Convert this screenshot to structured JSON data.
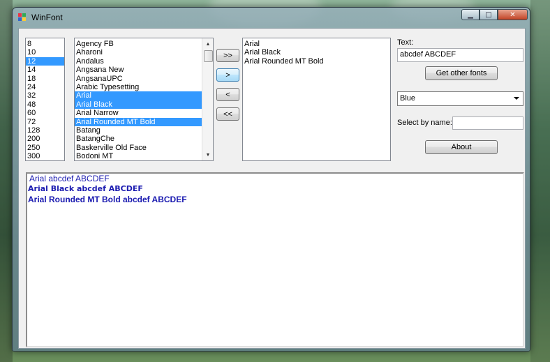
{
  "window": {
    "title": "WinFont",
    "min_glyph": "▁",
    "max_glyph": "□",
    "close_glyph": "✕"
  },
  "sizes": {
    "items": [
      "8",
      "10",
      "12",
      "14",
      "18",
      "24",
      "32",
      "48",
      "60",
      "72",
      "128",
      "200",
      "250",
      "300"
    ],
    "selected": "12"
  },
  "fonts": {
    "items": [
      "Agency FB",
      "Aharoni",
      "Andalus",
      "Angsana New",
      "AngsanaUPC",
      "Arabic Typesetting",
      "Arial",
      "Arial Black",
      "Arial Narrow",
      "Arial Rounded MT Bold",
      "Batang",
      "BatangChe",
      "Baskerville Old Face",
      "Bodoni MT"
    ],
    "selected": [
      "Arial",
      "Arial Black",
      "Arial Rounded MT Bold"
    ],
    "scroll_up": "▲",
    "scroll_down": "▼"
  },
  "transfer": {
    "add_all": ">>",
    "add": ">",
    "remove": "<",
    "remove_all": "<<"
  },
  "chosen": {
    "items": [
      "Arial",
      "Arial Black",
      "Arial Rounded MT Bold"
    ]
  },
  "controls": {
    "text_label": "Text:",
    "text_value": "abcdef ABCDEF",
    "get_other_fonts": "Get other fonts",
    "color_value": "Blue",
    "select_by_name_label": "Select by name:",
    "select_by_name_value": "",
    "about": "About"
  },
  "preview": {
    "color": "#1a1ab0",
    "lines": [
      "Arial abcdef ABCDEF",
      "Arial Black abcdef ABCDEF",
      "Arial Rounded MT Bold abcdef ABCDEF"
    ]
  }
}
